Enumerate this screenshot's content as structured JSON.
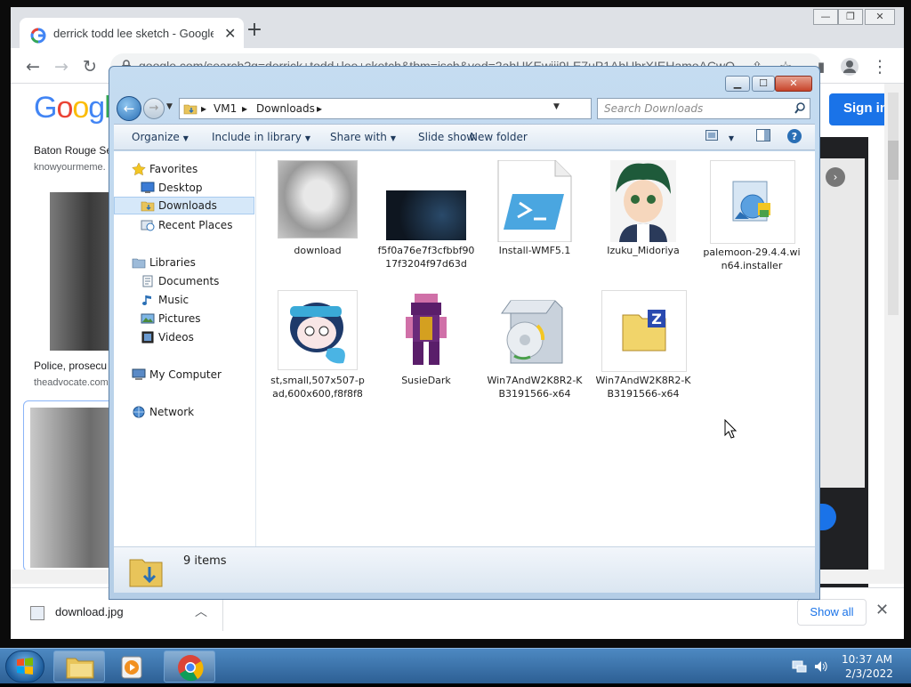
{
  "chrome": {
    "tab_title": "derrick todd lee sketch - Google",
    "new_tab": "+",
    "url": "google.com/search?q=derrick+todd+lee+sketch&tbm=isch&ved=2ahUKEwiii9LE7uP1AhUbrXIEHamoACwQ",
    "logo": "Google",
    "sign_in": "Sign in",
    "results": [
      {
        "title": "Baton Rouge Se",
        "source": "knowyourmeme."
      },
      {
        "title": "Police, prosecu",
        "source": "theadvocate.com"
      }
    ],
    "download_file": "download.jpg",
    "show_all": "Show all"
  },
  "explorer": {
    "breadcrumb": [
      "VM1",
      "Downloads"
    ],
    "search_placeholder": "Search Downloads",
    "commands": [
      "Organize",
      "Include in library",
      "Share with",
      "Slide show",
      "New folder"
    ],
    "nav": {
      "favorites": "Favorites",
      "desktop": "Desktop",
      "downloads": "Downloads",
      "recent": "Recent Places",
      "libraries": "Libraries",
      "documents": "Documents",
      "music": "Music",
      "pictures": "Pictures",
      "videos": "Videos",
      "computer": "My Computer",
      "network": "Network"
    },
    "files": [
      {
        "name": "download"
      },
      {
        "name": "f5f0a76e7f3cfbbf9017f3204f97d63d"
      },
      {
        "name": "Install-WMF5.1"
      },
      {
        "name": "Izuku_Midoriya"
      },
      {
        "name": "palemoon-29.4.4.win64.installer"
      },
      {
        "name": "st,small,507x507-pad,600x600,f8f8f8"
      },
      {
        "name": "SusieDark"
      },
      {
        "name": "Win7AndW2K8R2-KB3191566-x64"
      },
      {
        "name": "Win7AndW2K8R2-KB3191566-x64"
      }
    ],
    "item_count": "9 items"
  },
  "taskbar": {
    "time": "10:37 AM",
    "date": "2/3/2022"
  },
  "colors": {
    "chrome_blue": "#1a73e8",
    "taskbar": "#2d5f94"
  }
}
